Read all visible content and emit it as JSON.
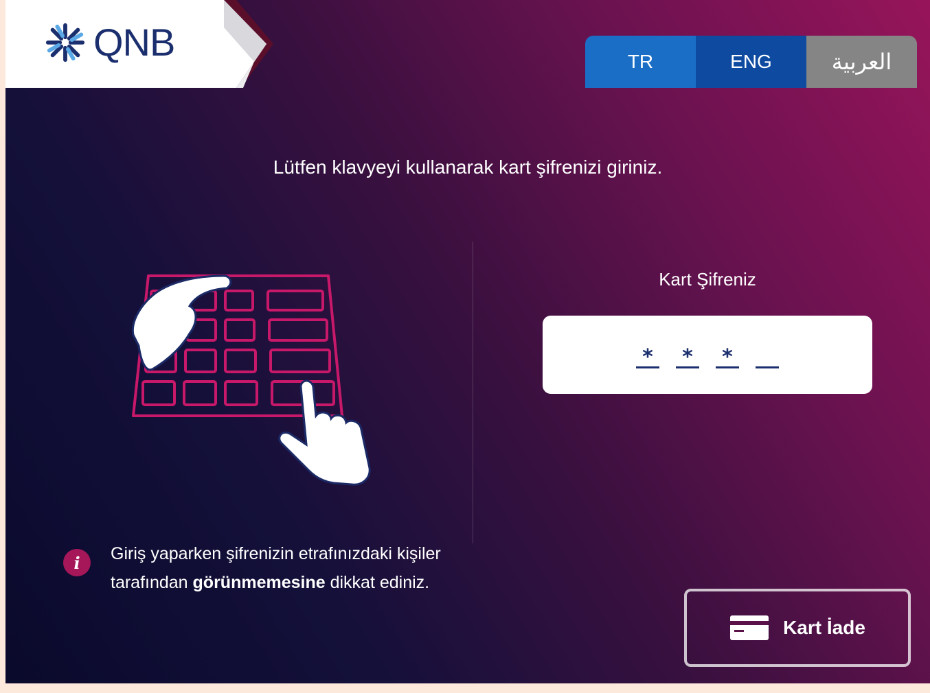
{
  "brand": {
    "name": "QNB"
  },
  "languages": {
    "tr": "TR",
    "eng": "ENG",
    "ar": "العربية"
  },
  "instruction": "Lütfen klavyeyi kullanarak kart şifrenizi giriniz.",
  "pin": {
    "label": "Kart Şifreniz",
    "digits": [
      "*",
      "*",
      "*",
      ""
    ],
    "entered_count": 3,
    "total_length": 4
  },
  "info": {
    "icon": "i",
    "text_before": "Giriş yaparken şifrenizin etrafınızdaki kişiler tarafından ",
    "text_bold": "görünmemesine",
    "text_after": " dikkat ediniz."
  },
  "card_return": {
    "label": "Kart İade",
    "icon": "card-icon"
  },
  "colors": {
    "brand_navy": "#1b2f6e",
    "lang_tr": "#1a6ec6",
    "lang_eng": "#0d4aa0",
    "lang_ar": "#858585",
    "accent_magenta": "#a6175a",
    "keypad_outline": "#c8186a"
  }
}
